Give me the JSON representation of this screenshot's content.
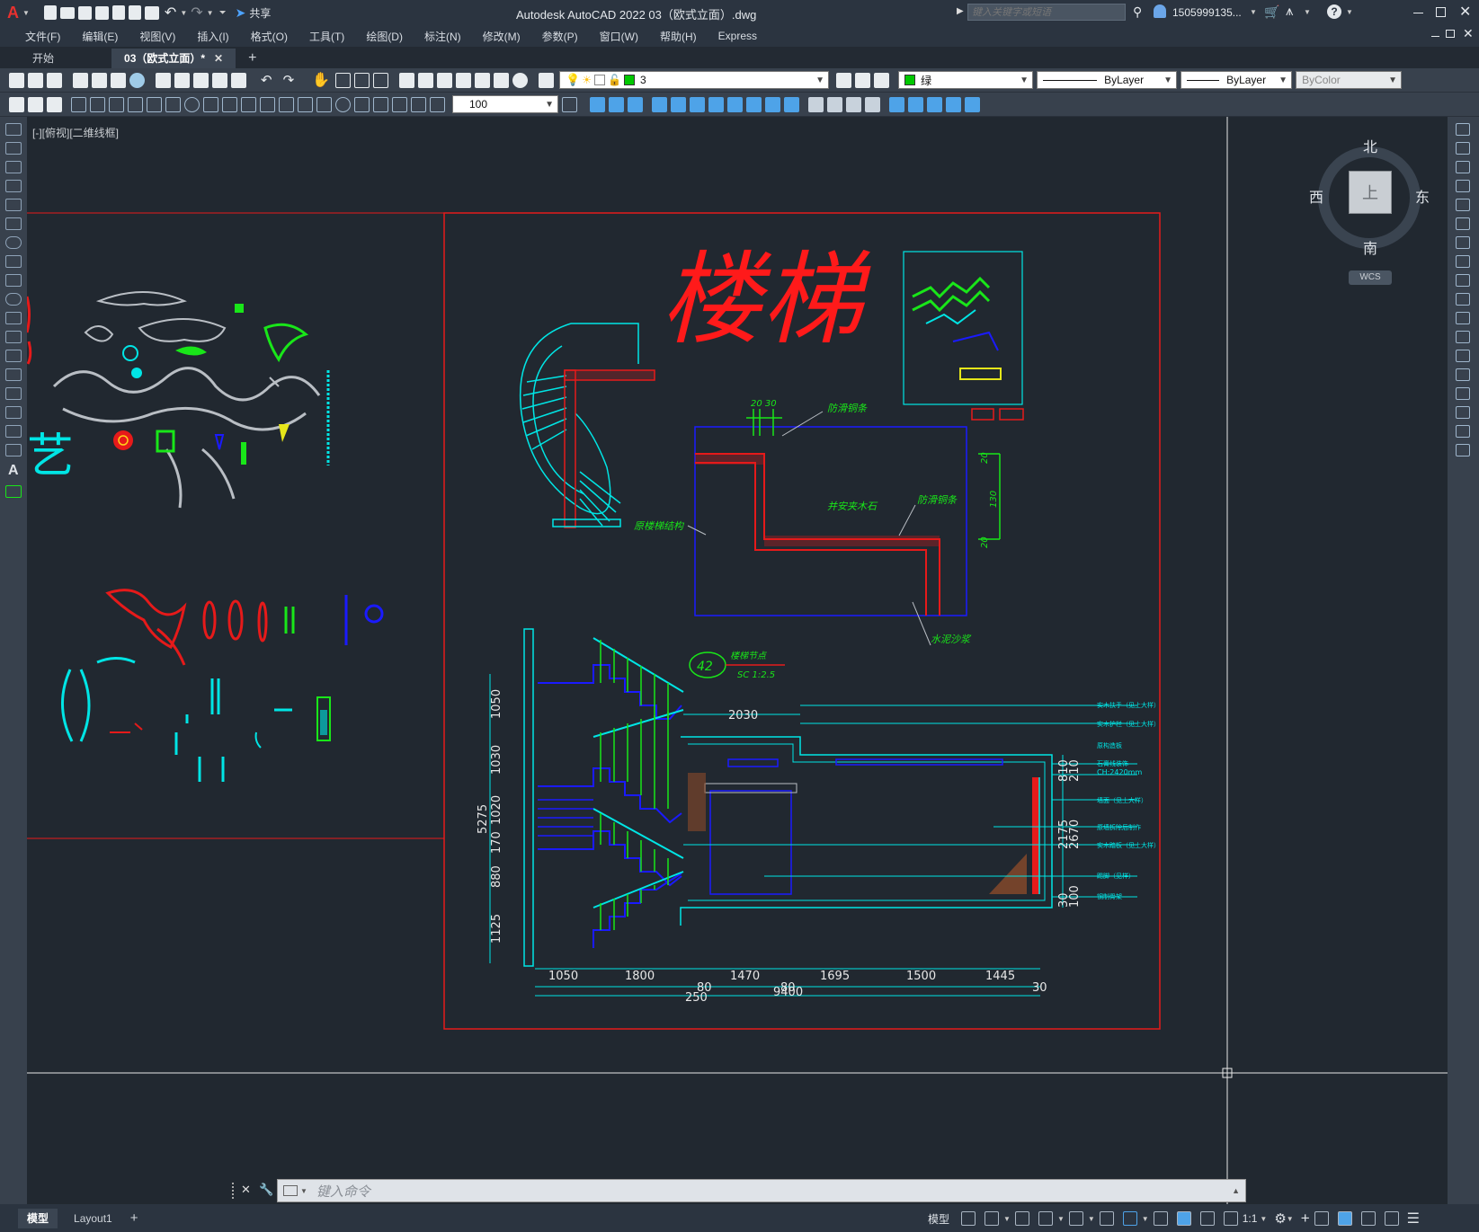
{
  "window": {
    "title": "Autodesk AutoCAD 2022    03（欧式立面）.dwg",
    "share_label": "共享",
    "search_placeholder": "键入关键字或短语",
    "user_name": "1505999135...",
    "app_letter": "A"
  },
  "menu": [
    "文件(F)",
    "编辑(E)",
    "视图(V)",
    "插入(I)",
    "格式(O)",
    "工具(T)",
    "绘图(D)",
    "标注(N)",
    "修改(M)",
    "参数(P)",
    "窗口(W)",
    "帮助(H)",
    "Express"
  ],
  "tabs": {
    "start": "开始",
    "document": "03（欧式立面）*",
    "add": "+"
  },
  "properties": {
    "layer": "3",
    "color": "绿",
    "linetype": "ByLayer",
    "lineweight": "ByLayer",
    "plotstyle": "ByColor",
    "dimscale": "100",
    "layer_color": "#00c800"
  },
  "viewport_label": "[-][俯视][二维线框]",
  "viewcube": {
    "north": "北",
    "south": "南",
    "east": "东",
    "west": "西",
    "face": "上",
    "wcs": "WCS"
  },
  "drawing": {
    "title": "楼梯",
    "partial_glyph": "艺",
    "annotations": {
      "anti_slip_top": "防滑铜条",
      "anti_slip_right": "防滑铜条",
      "structure": "原楼梯结构",
      "fixed_mortar": "并安夹木石",
      "cement_sand": "水泥沙浆",
      "node_label": "楼梯节点",
      "node_number": "42",
      "node_scale": "SC 1:2.5",
      "dim_20_30": "20  30",
      "dim_20a": "20",
      "dim_130": "130",
      "dim_20b": "20",
      "ch_height": "CH:2420mm"
    },
    "right_notes": [
      "实木扶手（见上大样）",
      "实木护栏（见上大样）",
      "原构造板",
      "石膏线装饰",
      "墙面（见上大样）",
      "原墙拆除后制作",
      "实木踏板（见上大样）",
      "踢脚（见样）",
      "钢制骨架"
    ],
    "dims_bottom": [
      "1050",
      "1800",
      "1470",
      "1695",
      "1500",
      "1445"
    ],
    "dims_bottom_small": [
      "80",
      "80",
      "30"
    ],
    "dim_total": "9400",
    "dim_250": "250",
    "dim_2030": "2030",
    "dims_left": [
      "1050",
      "1030",
      "1020",
      "170",
      "880",
      "1125"
    ],
    "dim_left_total": "5275",
    "dims_right_top": [
      "810",
      "210"
    ],
    "dims_right_mid": [
      "2175",
      "2670"
    ],
    "dims_right_bot": [
      "30",
      "100"
    ]
  },
  "command": {
    "placeholder": "键入命令"
  },
  "status": {
    "model_tab": "模型",
    "layout_tab": "Layout1",
    "add": "+",
    "model_button": "模型",
    "scale": "1:1"
  },
  "colors": {
    "accent_red": "#ff1a1a",
    "cyan": "#00e5e5",
    "green": "#19e619",
    "blue": "#1a1aff",
    "background": "#212830"
  }
}
